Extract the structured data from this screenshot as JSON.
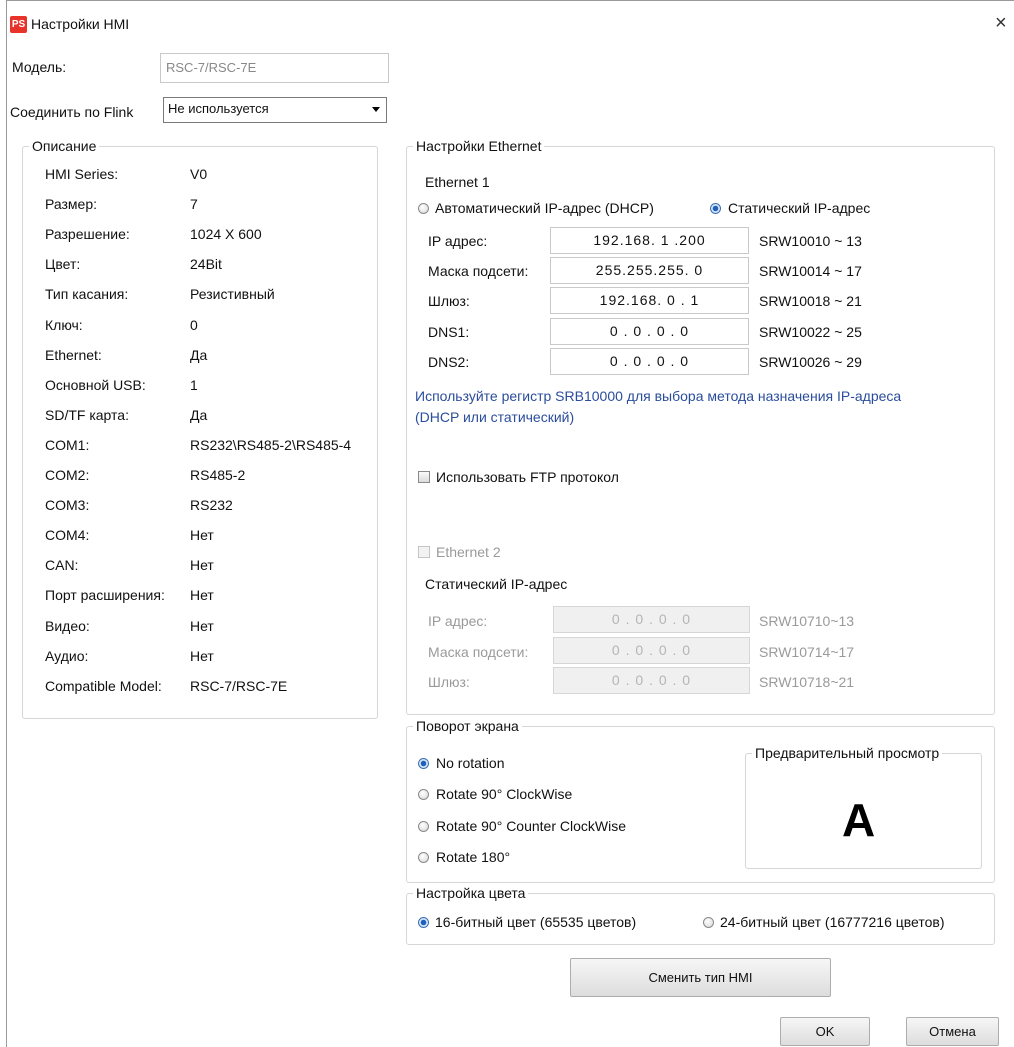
{
  "window": {
    "title": "Настройки HMI",
    "icon_text": "PS",
    "close": "×"
  },
  "model": {
    "label": "Модель:",
    "value": "RSC-7/RSC-7E"
  },
  "flink": {
    "label": "Соединить по Flink",
    "selected": "Не используется"
  },
  "description": {
    "legend": "Описание",
    "rows": [
      {
        "label": "HMI Series:",
        "value": "V0"
      },
      {
        "label": "Размер:",
        "value": "7"
      },
      {
        "label": "Разрешение:",
        "value": "1024 X 600"
      },
      {
        "label": "Цвет:",
        "value": "24Bit"
      },
      {
        "label": "Тип касания:",
        "value": "Резистивный"
      },
      {
        "label": "Ключ:",
        "value": "0"
      },
      {
        "label": "Ethernet:",
        "value": "Да"
      },
      {
        "label": "Основной USB:",
        "value": "1"
      },
      {
        "label": "SD/TF карта:",
        "value": "Да"
      },
      {
        "label": "COM1:",
        "value": "RS232\\RS485-2\\RS485-4"
      },
      {
        "label": "COM2:",
        "value": "RS485-2"
      },
      {
        "label": "COM3:",
        "value": "RS232"
      },
      {
        "label": "COM4:",
        "value": "Нет"
      },
      {
        "label": "CAN:",
        "value": "Нет"
      },
      {
        "label": "Порт расширения:",
        "value": "Нет"
      },
      {
        "label": "Видео:",
        "value": "Нет"
      },
      {
        "label": "Аудио:",
        "value": "Нет"
      },
      {
        "label": "Compatible Model:",
        "value": "RSC-7/RSC-7E"
      }
    ]
  },
  "ethernet": {
    "legend": "Настройки Ethernet",
    "eth1_title": "Ethernet 1",
    "dhcp_label": "Автоматический IP-адрес (DHCP)",
    "static_label": "Статический IP-адрес",
    "mode": "static",
    "rows": [
      {
        "label": "IP адрес:",
        "value": "192.168. 1 .200",
        "reg": "SRW10010 ~ 13"
      },
      {
        "label": "Маска подсети:",
        "value": "255.255.255. 0",
        "reg": "SRW10014 ~ 17"
      },
      {
        "label": "Шлюз:",
        "value": "192.168. 0 . 1",
        "reg": "SRW10018 ~ 21"
      },
      {
        "label": "DNS1:",
        "value": "0 . 0 . 0 . 0",
        "reg": "SRW10022 ~ 25"
      },
      {
        "label": "DNS2:",
        "value": "0 . 0 . 0 . 0",
        "reg": "SRW10026 ~ 29"
      }
    ],
    "note_line1": "Используйте регистр SRB10000 для выбора метода назначения IP-адреса",
    "note_line2": "(DHCP или статический)",
    "ftp_label": "Использовать FTP протокол",
    "ftp_checked": false,
    "eth2_label": "Ethernet 2",
    "eth2_checked": false,
    "eth2_static_title": "Статический IP-адрес",
    "eth2_rows": [
      {
        "label": "IP адрес:",
        "value": "0 . 0 . 0 . 0",
        "reg": "SRW10710~13"
      },
      {
        "label": "Маска подсети:",
        "value": "0 . 0 . 0 . 0",
        "reg": "SRW10714~17"
      },
      {
        "label": "Шлюз:",
        "value": "0 . 0 . 0 . 0",
        "reg": "SRW10718~21"
      }
    ]
  },
  "rotation": {
    "legend": "Поворот экрана",
    "options": [
      "No rotation",
      "Rotate 90° ClockWise",
      "Rotate 90° Counter ClockWise",
      "Rotate 180°"
    ],
    "selected": "No rotation",
    "preview_legend": "Предварительный просмотр",
    "preview_letter": "A"
  },
  "color": {
    "legend": "Настройка цвета",
    "options": [
      "16-битный цвет (65535 цветов)",
      "24-битный цвет (16777216 цветов)"
    ],
    "selected": "16-битный цвет (65535 цветов)"
  },
  "buttons": {
    "change_type": "Сменить тип HMI",
    "ok": "OK",
    "cancel": "Отмена"
  },
  "colors": {
    "note_blue": "#2a4d9c",
    "radio_blue": "#1e5fbf",
    "icon_red": "#e8332a"
  }
}
